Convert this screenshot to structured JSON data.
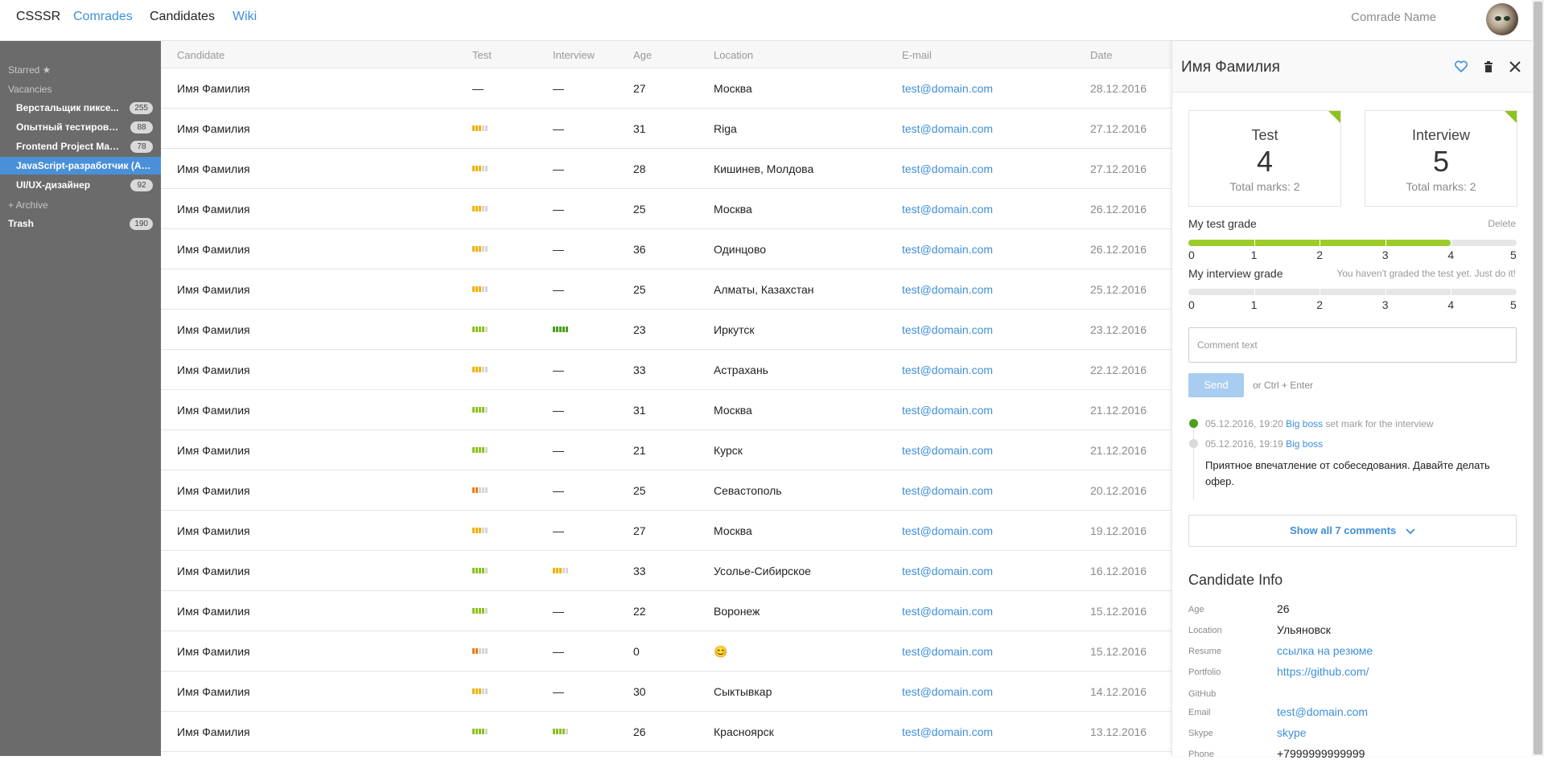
{
  "nav": {
    "brand": "CSSSR",
    "links": [
      {
        "label": "Comrades",
        "color": "#3f8fd9"
      },
      {
        "label": "Candidates",
        "color": "#222222"
      },
      {
        "label": "Wiki",
        "color": "#3f8fd9"
      }
    ],
    "user_name": "Comrade Name"
  },
  "sidebar": {
    "starred": "Starred ★",
    "vacancies": "Vacancies",
    "items": [
      {
        "label": "Верстальщик пиксе...",
        "count": "255"
      },
      {
        "label": "Опытный тестировщ...",
        "count": "88"
      },
      {
        "label": "Frontend Project Mana...",
        "count": "78"
      },
      {
        "label": "JavaScript-разработчик (Ang...",
        "count": ""
      },
      {
        "label": "UI/UX-дизайнер",
        "count": "92"
      }
    ],
    "archive": "+ Archive",
    "trash": {
      "label": "Trash",
      "count": "190"
    }
  },
  "table": {
    "headers": [
      "Candidate",
      "Test",
      "Interview",
      "Age",
      "Location",
      "E-mail",
      "Date"
    ],
    "rows": [
      {
        "name": "Имя Фамилия",
        "test": "—",
        "interview": "—",
        "age": "27",
        "location": "Москва",
        "email": "test@domain.com",
        "date": "28.12.2016"
      },
      {
        "name": "Имя Фамилия",
        "test_level": 3,
        "test_color": "#f2b200",
        "interview": "—",
        "age": "31",
        "location": "Riga",
        "email": "test@domain.com",
        "date": "27.12.2016"
      },
      {
        "name": "Имя Фамилия",
        "test_level": 3,
        "test_color": "#f2b200",
        "interview": "—",
        "age": "28",
        "location": "Кишинев, Молдова",
        "email": "test@domain.com",
        "date": "27.12.2016"
      },
      {
        "name": "Имя Фамилия",
        "test_level": 3,
        "test_color": "#f2b200",
        "interview": "—",
        "age": "25",
        "location": "Москва",
        "email": "test@domain.com",
        "date": "26.12.2016"
      },
      {
        "name": "Имя Фамилия",
        "test_level": 3,
        "test_color": "#f2b200",
        "interview": "—",
        "age": "36",
        "location": "Одинцово",
        "email": "test@domain.com",
        "date": "26.12.2016"
      },
      {
        "name": "Имя Фамилия",
        "test_level": 3,
        "test_color": "#f2b200",
        "interview": "—",
        "age": "25",
        "location": "Алматы, Казахстан",
        "email": "test@domain.com",
        "date": "25.12.2016"
      },
      {
        "name": "Имя Фамилия",
        "test_level": 4,
        "test_color": "#8cc320",
        "interview_level": 5,
        "interview_color": "#4aa01a",
        "age": "23",
        "location": "Иркутск",
        "email": "test@domain.com",
        "date": "23.12.2016"
      },
      {
        "name": "Имя Фамилия",
        "test_level": 3,
        "test_color": "#f2b200",
        "interview": "—",
        "age": "33",
        "location": "Астрахань",
        "email": "test@domain.com",
        "date": "22.12.2016"
      },
      {
        "name": "Имя Фамилия",
        "test_level": 4,
        "test_color": "#8cc320",
        "interview": "—",
        "age": "31",
        "location": "Москва",
        "email": "test@domain.com",
        "date": "21.12.2016"
      },
      {
        "name": "Имя Фамилия",
        "test_level": 4,
        "test_color": "#8cc320",
        "interview": "—",
        "age": "21",
        "location": "Курск",
        "email": "test@domain.com",
        "date": "21.12.2016"
      },
      {
        "name": "Имя Фамилия",
        "test_level": 2,
        "test_color": "#f07a12",
        "interview": "—",
        "age": "25",
        "location": "Севастополь",
        "email": "test@domain.com",
        "date": "20.12.2016"
      },
      {
        "name": "Имя Фамилия",
        "test_level": 3,
        "test_color": "#f2b200",
        "interview": "—",
        "age": "27",
        "location": "Москва",
        "email": "test@domain.com",
        "date": "19.12.2016"
      },
      {
        "name": "Имя Фамилия",
        "test_level": 4,
        "test_color": "#8cc320",
        "interview_level": 3,
        "interview_color": "#f2b200",
        "age": "33",
        "location": "Усолье-Сибирское",
        "email": "test@domain.com",
        "date": "16.12.2016"
      },
      {
        "name": "Имя Фамилия",
        "test_level": 4,
        "test_color": "#8cc320",
        "interview": "—",
        "age": "22",
        "location": "Воронеж",
        "email": "test@domain.com",
        "date": "15.12.2016"
      },
      {
        "name": "Имя Фамилия",
        "test_level": 2,
        "test_color": "#f07a12",
        "interview": "—",
        "age": "0",
        "location": "😊",
        "email": "test@domain.com",
        "date": "15.12.2016"
      },
      {
        "name": "Имя Фамилия",
        "test_level": 3,
        "test_color": "#f2b200",
        "interview": "—",
        "age": "30",
        "location": "Сыктывкар",
        "email": "test@domain.com",
        "date": "14.12.2016"
      },
      {
        "name": "Имя Фамилия",
        "test_level": 4,
        "test_color": "#8cc320",
        "interview_level": 4,
        "interview_color": "#8cc320",
        "age": "26",
        "location": "Красноярск",
        "email": "test@domain.com",
        "date": "13.12.2016"
      }
    ]
  },
  "panel": {
    "title": "Имя Фамилия",
    "icons": [
      "heart-icon",
      "trash-icon",
      "close-icon"
    ],
    "test": {
      "label": "Test",
      "value": "4",
      "total": "Total marks: 2"
    },
    "interview": {
      "label": "Interview",
      "value": "5",
      "total": "Total marks: 2"
    },
    "my_test_grade": {
      "title": "My test grade",
      "action": "Delete",
      "value_fraction": 0.8
    },
    "my_interview_grade": {
      "title": "My interview grade",
      "hint": "You haven't graded the test yet. Just do it!",
      "value_fraction": 0
    },
    "scale": [
      "0",
      "1",
      "2",
      "3",
      "4",
      "5"
    ],
    "comment_placeholder": "Comment text",
    "send_label": "Send",
    "send_hint": "or Ctrl + Enter",
    "timeline": [
      {
        "time": "05.12.2016, 19:20",
        "author": "Big boss",
        "action": "set mark for the interview",
        "dot_color": "#4aa01a"
      },
      {
        "time": "05.12.2016, 19:19",
        "author": "Big boss",
        "action": "",
        "dot_color": "#d9d9d9",
        "comment": "Приятное впечатление от собеседования. Давайте делать офер."
      }
    ],
    "show_all": "Show all 7 comments",
    "info_title": "Candidate Info",
    "info": [
      {
        "key": "Age",
        "value": "26",
        "link": false
      },
      {
        "key": "Location",
        "value": "Ульяновск",
        "link": false
      },
      {
        "key": "Resume",
        "value": "ссылка на резюме",
        "link": true
      },
      {
        "key": "Portfolio",
        "value": "https://github.com/",
        "link": true
      },
      {
        "key": "GitHub",
        "value": "",
        "link": false
      },
      {
        "key": "Email",
        "value": "test@domain.com",
        "link": true
      },
      {
        "key": "Skype",
        "value": "skype",
        "link": true
      },
      {
        "key": "Phone",
        "value": "+7999999999999",
        "link": false
      }
    ]
  }
}
